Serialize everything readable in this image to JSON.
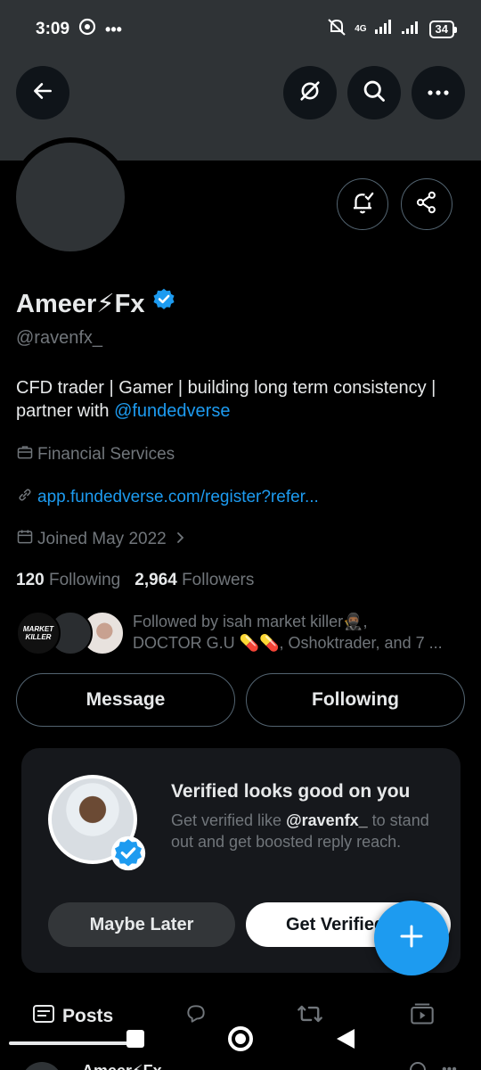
{
  "status": {
    "time": "3:09",
    "net": "4G",
    "battery": "34"
  },
  "profile": {
    "name": "Ameer⚡Fx",
    "handle": "@ravenfx_",
    "bio_text": "CFD trader | Gamer | building long term consistency | partner with ",
    "bio_mention": "@fundedverse",
    "category": "Financial Services",
    "website": "app.fundedverse.com/register?refer...",
    "joined": "Joined May 2022",
    "following_count": "120",
    "following_label": "Following",
    "followers_count": "2,964",
    "followers_label": "Followers",
    "followed_by_line1": "Followed by isah market killer🥷🏾,",
    "followed_by_line2": "DOCTOR G.U 💊💊, Oshoktrader, and 7 ...",
    "follower_avatar_text": "MARKET KILLER"
  },
  "actions": {
    "message": "Message",
    "following": "Following"
  },
  "verify_card": {
    "title": "Verified looks good on you",
    "text_before": "Get verified like ",
    "text_handle": "@ravenfx_",
    "text_after": " to stand out and get boosted reply reach.",
    "later": "Maybe Later",
    "verify": "Get Verified"
  },
  "tabs": {
    "posts": "Posts"
  },
  "peek": {
    "name": "Ameer⚡Fx"
  },
  "colors": {
    "accent": "#1d9bf0",
    "background": "#000000",
    "banner": "#2f3336"
  },
  "icons": [
    "back-arrow-icon",
    "no-data-icon",
    "search-icon",
    "more-icon",
    "bell-check-icon",
    "share-icon",
    "verified-badge-icon",
    "briefcase-icon",
    "link-icon",
    "calendar-icon",
    "chevron-right-icon",
    "plus-icon",
    "posts-icon",
    "reply-icon",
    "repost-icon",
    "video-icon"
  ]
}
